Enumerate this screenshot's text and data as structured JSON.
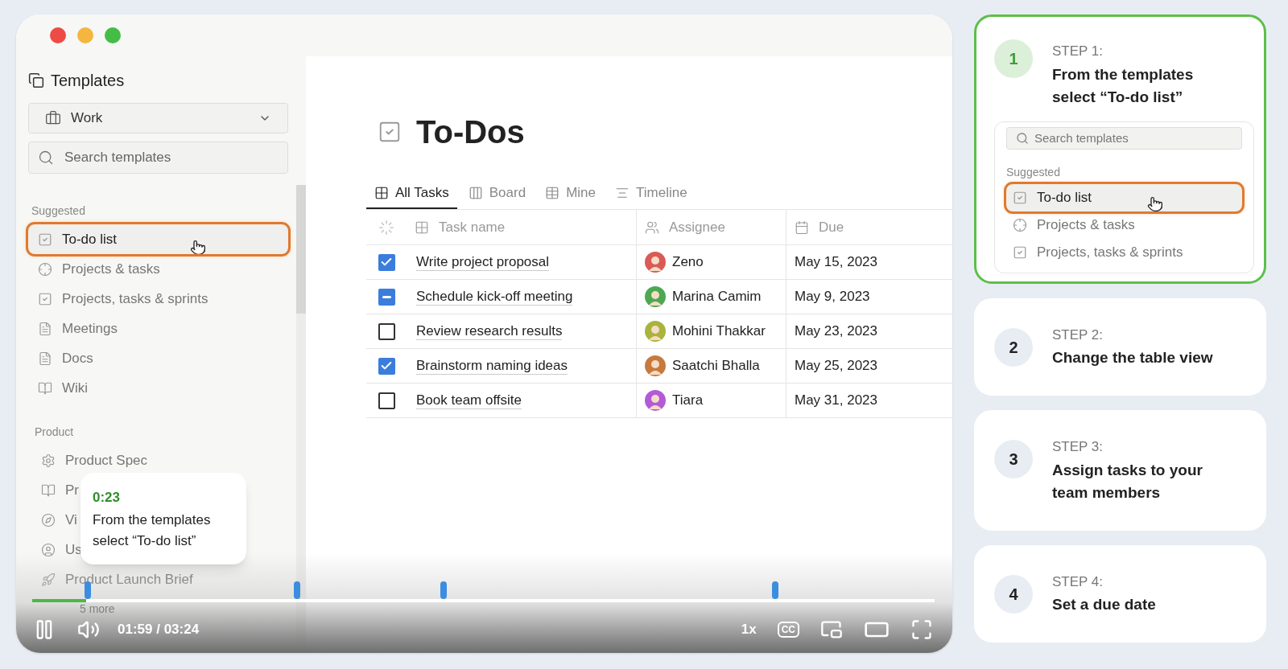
{
  "sidebar": {
    "title": "Templates",
    "workspace_select": {
      "value": "Work"
    },
    "search": {
      "placeholder": "Search templates"
    },
    "sections": [
      {
        "heading": "Suggested",
        "items": [
          {
            "label": "To-do list",
            "selected": true
          },
          {
            "label": "Projects & tasks",
            "selected": false
          },
          {
            "label": "Projects, tasks & sprints",
            "selected": false
          },
          {
            "label": "Meetings",
            "selected": false
          },
          {
            "label": "Docs",
            "selected": false
          },
          {
            "label": "Wiki",
            "selected": false
          }
        ]
      },
      {
        "heading": "Product",
        "items": [
          {
            "label": "Product Spec",
            "selected": false
          },
          {
            "label": "Pr",
            "selected": false
          },
          {
            "label": "Vi",
            "selected": false
          },
          {
            "label": "Us",
            "selected": false
          },
          {
            "label": "Product Launch Brief",
            "selected": false
          }
        ]
      }
    ],
    "more_link": "5 more"
  },
  "page": {
    "title": "To-Dos",
    "tabs": [
      {
        "label": "All Tasks",
        "selected": true
      },
      {
        "label": "Board",
        "selected": false
      },
      {
        "label": "Mine",
        "selected": false
      },
      {
        "label": "Timeline",
        "selected": false
      }
    ],
    "table": {
      "columns": [
        {
          "label": "Task name"
        },
        {
          "label": "Assignee"
        },
        {
          "label": "Due"
        }
      ],
      "rows": [
        {
          "checked": true,
          "indeterminate": false,
          "task": "Write project proposal",
          "assignee": "Zeno",
          "color": "#d95a56",
          "due": "May 15, 2023"
        },
        {
          "checked": false,
          "indeterminate": true,
          "task": "Schedule kick-off meeting",
          "assignee": "Marina Camim",
          "color": "#4ea852",
          "due": "May 9, 2023"
        },
        {
          "checked": false,
          "indeterminate": false,
          "task": "Review research results",
          "assignee": "Mohini Thakkar",
          "color": "#a8b43c",
          "due": "May 23, 2023"
        },
        {
          "checked": true,
          "indeterminate": false,
          "task": "Brainstorm naming ideas",
          "assignee": "Saatchi Bhalla",
          "color": "#c77a3e",
          "due": "May 25, 2023"
        },
        {
          "checked": false,
          "indeterminate": false,
          "task": "Book team offsite",
          "assignee": "Tiara",
          "color": "#b35ad8",
          "due": "May 31, 2023"
        }
      ]
    }
  },
  "player": {
    "playing": true,
    "tooltip": {
      "time": "0:23",
      "text": "From the templates select “To-do list”"
    },
    "progress": {
      "level": 0.06
    },
    "time": "01:59 / 03:24",
    "speed": "1x",
    "captions": "CC"
  },
  "steps": [
    {
      "label": "STEP 1:",
      "number": "1",
      "title": "From the templates select “To-do list”",
      "selected": true,
      "preview": {
        "search": {
          "placeholder": "Search templates"
        },
        "heading": "Suggested",
        "items": [
          {
            "label": "To-do list",
            "selected": true
          },
          {
            "label": "Projects & tasks",
            "selected": false
          },
          {
            "label": "Projects, tasks & sprints",
            "selected": false
          }
        ]
      }
    },
    {
      "label": "STEP 2:",
      "number": "2",
      "title": "Change the table view",
      "selected": false
    },
    {
      "label": "STEP 3:",
      "number": "3",
      "title": "Assign tasks to your team members",
      "selected": false
    },
    {
      "label": "STEP 4:",
      "number": "4",
      "title": "Set a due date",
      "selected": false
    }
  ]
}
